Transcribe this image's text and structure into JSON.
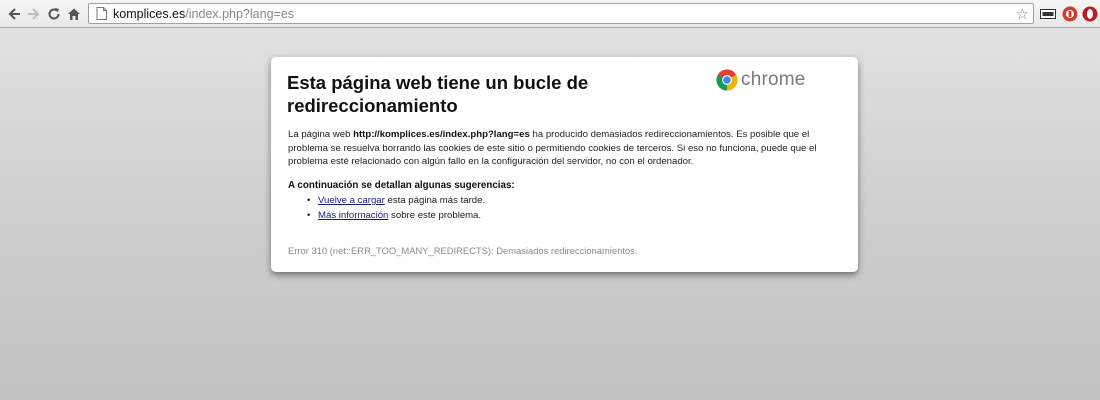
{
  "toolbar": {
    "back_icon": "back-arrow-icon",
    "forward_icon": "forward-arrow-icon",
    "reload_icon": "reload-icon",
    "home_icon": "home-icon",
    "url_host": "komplices.es",
    "url_path": "/index.php?lang=es",
    "star_icon": "star-icon",
    "extensions": [
      "page-action-icon",
      "red-extension-icon",
      "opera-like-extension-icon"
    ]
  },
  "error_page": {
    "title": "Esta página web tiene un bucle de redireccionamiento",
    "brand_word": "chrome",
    "desc_part1": "La página web ",
    "desc_url": "http://komplices.es/index.php?lang=es",
    "desc_part2": " ha producido demasiados redireccionamientos. Es posible que el problema se resuelva borrando las cookies de este sitio o permitiendo cookies de terceros. Si eso no funciona, puede que el problema esté relacionado con algún fallo en la configuración del servidor, no con el ordenador.",
    "suggestions_title": "A continuación se detallan algunas sugerencias:",
    "suggestions": [
      {
        "link": "Vuelve a cargar",
        "text": " esta página más tarde."
      },
      {
        "link": "Más información",
        "text": " sobre este problema."
      }
    ],
    "error_code": "Error 310 (net::ERR_TOO_MANY_REDIRECTS): Demasiados redireccionamientos."
  },
  "colors": {
    "link": "#1a1a80",
    "background": "#c8c8c8",
    "card": "#ffffff"
  }
}
